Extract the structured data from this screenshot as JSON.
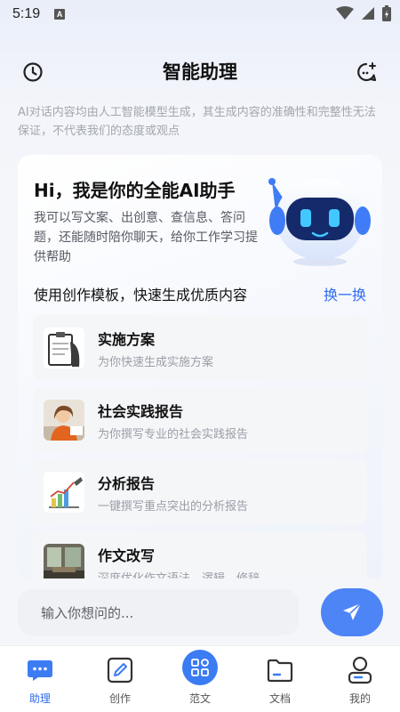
{
  "status": {
    "time": "5:19",
    "badge": "A"
  },
  "header": {
    "title": "智能助理",
    "left_icon": "clock-icon",
    "right_icon": "chat-bubble-plus-icon"
  },
  "disclaimer": "AI对话内容均由人工智能模型生成，其生成内容的准确性和完整性无法保证，不代表我们的态度或观点",
  "hero": {
    "title": "Hi，我是你的全能AI助手",
    "description": "我可以写文案、出创意、查信息、答问题，还能随时陪你聊天，给你工作学习提供帮助"
  },
  "templates": {
    "title": "使用创作模板，快速生成优质内容",
    "switch_label": "换一换",
    "items": [
      {
        "title": "实施方案",
        "subtitle": "为你快速生成实施方案"
      },
      {
        "title": "社会实践报告",
        "subtitle": "为你撰写专业的社会实践报告"
      },
      {
        "title": "分析报告",
        "subtitle": "一键撰写重点突出的分析报告"
      },
      {
        "title": "作文改写",
        "subtitle": "深度优化作文语法、逻辑、修辞"
      }
    ]
  },
  "input": {
    "placeholder": "输入你想问的..."
  },
  "tabs": [
    {
      "label": "助理",
      "icon": "chat-icon",
      "active": true
    },
    {
      "label": "创作",
      "icon": "edit-icon",
      "active": false
    },
    {
      "label": "范文",
      "icon": "grid-icon",
      "active": false
    },
    {
      "label": "文档",
      "icon": "folder-icon",
      "active": false
    },
    {
      "label": "我的",
      "icon": "user-icon",
      "active": false
    }
  ],
  "colors": {
    "accent": "#2f6bf0",
    "send": "#4d84f6",
    "muted": "#a2a6ae"
  }
}
